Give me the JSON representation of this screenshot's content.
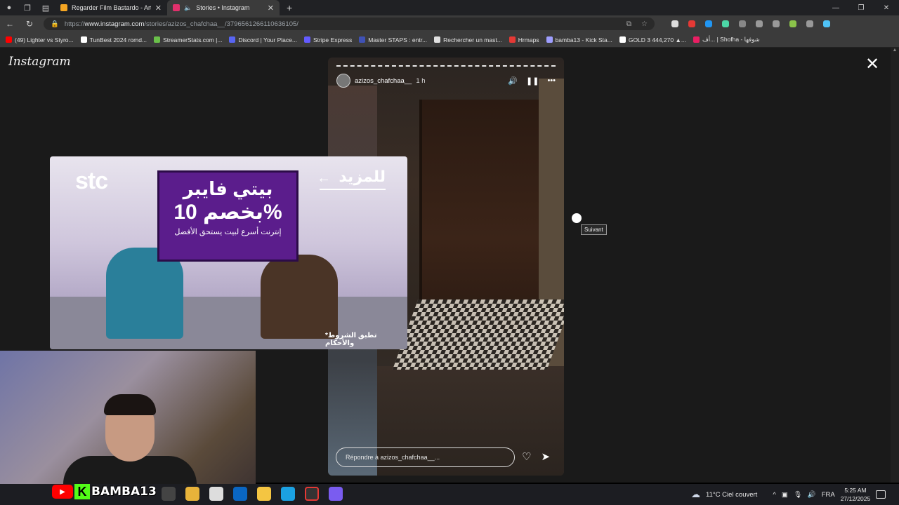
{
  "browser": {
    "tabs": [
      {
        "title": "Regarder Film Bastardo - Artify",
        "favicon_color": "#f5a623"
      },
      {
        "title": "Stories • Instagram",
        "favicon_color": "#e1306c",
        "active": true
      }
    ],
    "new_tab_symbol": "+",
    "url_protocol": "https://",
    "url_host": "www.instagram.com",
    "url_path": "/stories/azizos_chafchaa__/3796561266110636105/",
    "bookmarks": [
      {
        "label": "(49) Lighter vs Styro...",
        "color": "#ff0000"
      },
      {
        "label": "TunBest 2024 romd...",
        "color": "#ffffff"
      },
      {
        "label": "StreamerStats.com |...",
        "color": "#6ac04a"
      },
      {
        "label": "Discord | Your Place...",
        "color": "#5865f2"
      },
      {
        "label": "Stripe Express",
        "color": "#635bff"
      },
      {
        "label": "Master STAPS : entr...",
        "color": "#3f51b5"
      },
      {
        "label": "Rechercher un mast...",
        "color": "#e0e0e0"
      },
      {
        "label": "Hrmaps",
        "color": "#e53935"
      },
      {
        "label": "bamba13 - Kick Sta...",
        "color": "#9e9eff"
      },
      {
        "label": "GOLD 3 444,270 ▲...",
        "color": "#ffffff"
      },
      {
        "label": "أف... | Shofha - شوفها",
        "color": "#e91e63"
      }
    ]
  },
  "instagram": {
    "logo": "Instagram",
    "close_symbol": "✕",
    "story": {
      "username": "azizos_chafchaa__",
      "time": "1 h",
      "reply_placeholder": "Répondre à azizos_chafchaa__...",
      "next_tooltip": "Suivant"
    }
  },
  "ad": {
    "brand": "stc",
    "headline_1": "بيتي فايبر",
    "headline_2": "بخصم 10%",
    "subline": "إنترنت أسرع لبيت يستحق الأفضل",
    "more": "للمزيد",
    "terms": "*تطبق الشروط والأحكام"
  },
  "overlay": {
    "streamer": "BAMBA13"
  },
  "taskbar": {
    "weather": "11°C  Ciel couvert",
    "lang": "FRA",
    "time": "5:25 AM",
    "date": "27/12/2025"
  }
}
